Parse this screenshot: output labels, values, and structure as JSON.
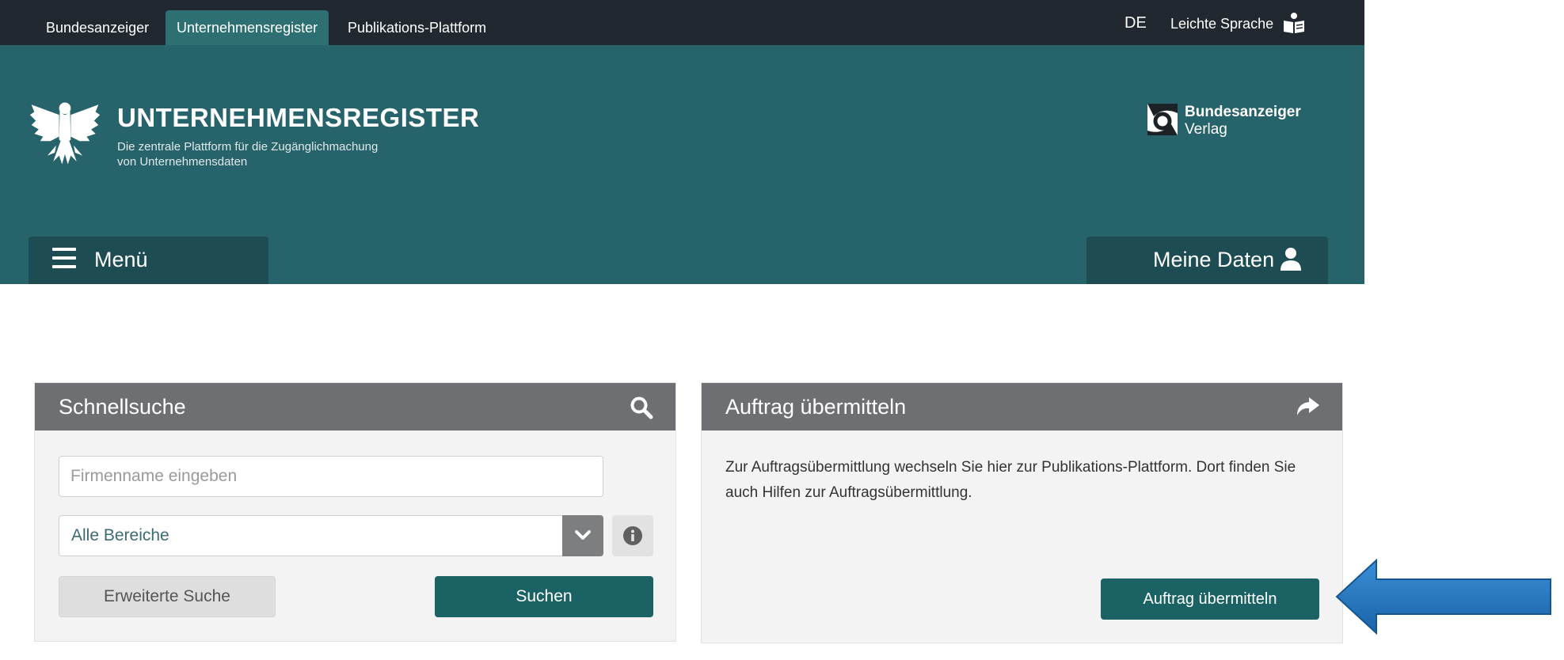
{
  "topnav": {
    "tabs": [
      {
        "label": "Bundesanzeiger",
        "active": false
      },
      {
        "label": "Unternehmensregister",
        "active": true
      },
      {
        "label": "Publikations-Plattform",
        "active": false
      }
    ],
    "language": "DE",
    "easy_language": "Leichte Sprache",
    "easy_language_icon": "book-reading-icon"
  },
  "banner": {
    "title": "UNTERNEHMENSREGISTER",
    "subtitle_line1": "Die zentrale Plattform für die Zugänglichmachung",
    "subtitle_line2": "von Unternehmensdaten",
    "publisher_name": "Bundesanzeiger",
    "publisher_sub": "Verlag",
    "menu_label": "Menü",
    "my_data_label": "Meine Daten"
  },
  "quicksearch": {
    "title": "Schnellsuche",
    "input_placeholder": "Firmenname eingeben",
    "input_value": "",
    "scope_selected": "Alle Bereiche",
    "advanced_label": "Erweiterte Suche",
    "search_label": "Suchen"
  },
  "order": {
    "title": "Auftrag übermitteln",
    "description": "Zur Auftragsübermittlung wechseln Sie hier zur Publikations-Plattform. Dort finden Sie auch Hilfen zur Auftragsübermittlung.",
    "button_label": "Auftrag übermitteln"
  },
  "colors": {
    "topbar": "#22282f",
    "banner": "#27636a",
    "active_tab": "#2d6f72",
    "dark_button": "#1e4c53",
    "primary_button": "#1b6265",
    "panel_header": "#6e6f72",
    "annotation_arrow": "#1f6fb5"
  }
}
